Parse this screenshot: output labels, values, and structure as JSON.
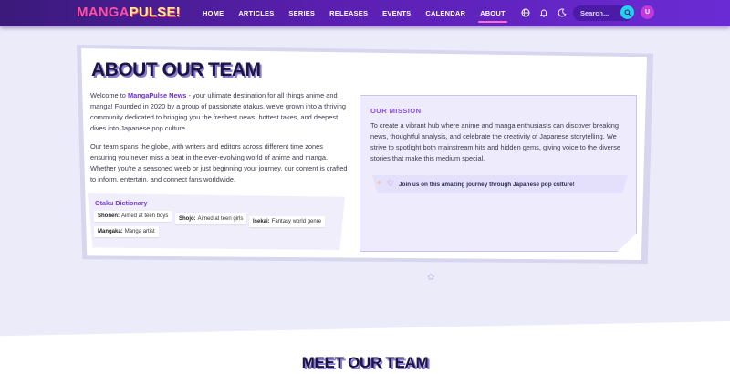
{
  "nav": {
    "logo_part1": "MANGA",
    "logo_part2": "PULSE!",
    "items": [
      {
        "label": "HOME"
      },
      {
        "label": "ARTICLES"
      },
      {
        "label": "SERIES"
      },
      {
        "label": "RELEASES"
      },
      {
        "label": "EVENTS"
      },
      {
        "label": "CALENDAR"
      },
      {
        "label": "ABOUT"
      }
    ],
    "active": "ABOUT",
    "search_placeholder": "Search...",
    "avatar_initial": "U",
    "icons": [
      "globe-icon",
      "bell-icon",
      "moon-icon",
      "search-icon"
    ]
  },
  "about": {
    "title": "ABOUT OUR TEAM",
    "p1_prefix": "Welcome to ",
    "p1_brand": "MangaPulse News",
    "p1_rest": " - your ultimate destination for all things anime and manga! Founded in 2020 by a group of passionate otakus, we've grown into a thriving community dedicated to bringing you the freshest news, hottest takes, and deepest dives into Japanese pop culture.",
    "p2": "Our team spans the globe, with writers and editors across different time zones ensuring you never miss a beat in the ever-evolving world of anime and manga. Whether you're a seasoned weeb or just beginning your journey, our content is crafted to inform, entertain, and connect fans worldwide.",
    "dictionary": {
      "title": "Otaku Dictionary",
      "terms": [
        {
          "term": "Shonen:",
          "def": "Aimed at teen boys"
        },
        {
          "term": "Shojo:",
          "def": "Aimed at teen girls"
        },
        {
          "term": "Isekai:",
          "def": "Fantasy world genre"
        },
        {
          "term": "Mangaka:",
          "def": "Manga artist"
        }
      ]
    }
  },
  "mission": {
    "title": "OUR MISSION",
    "text": "To create a vibrant hub where anime and manga enthusiasts can discover breaking news, thoughtful analysis, and celebrate the creativity of Japanese storytelling. We strive to spotlight both mainstream hits and hidden gems, giving voice to the diverse stories that make this medium special.",
    "banner": "Join us on this amazing journey through Japanese pop culture!"
  },
  "team": {
    "title": "MEET OUR TEAM"
  },
  "colors": {
    "accent": "#6b2bd4",
    "nav_bg": "#5a1fb0",
    "logo_pink": "#ff4fa3",
    "logo_yellow": "#fff08a",
    "search_button": "#22d3ee"
  }
}
